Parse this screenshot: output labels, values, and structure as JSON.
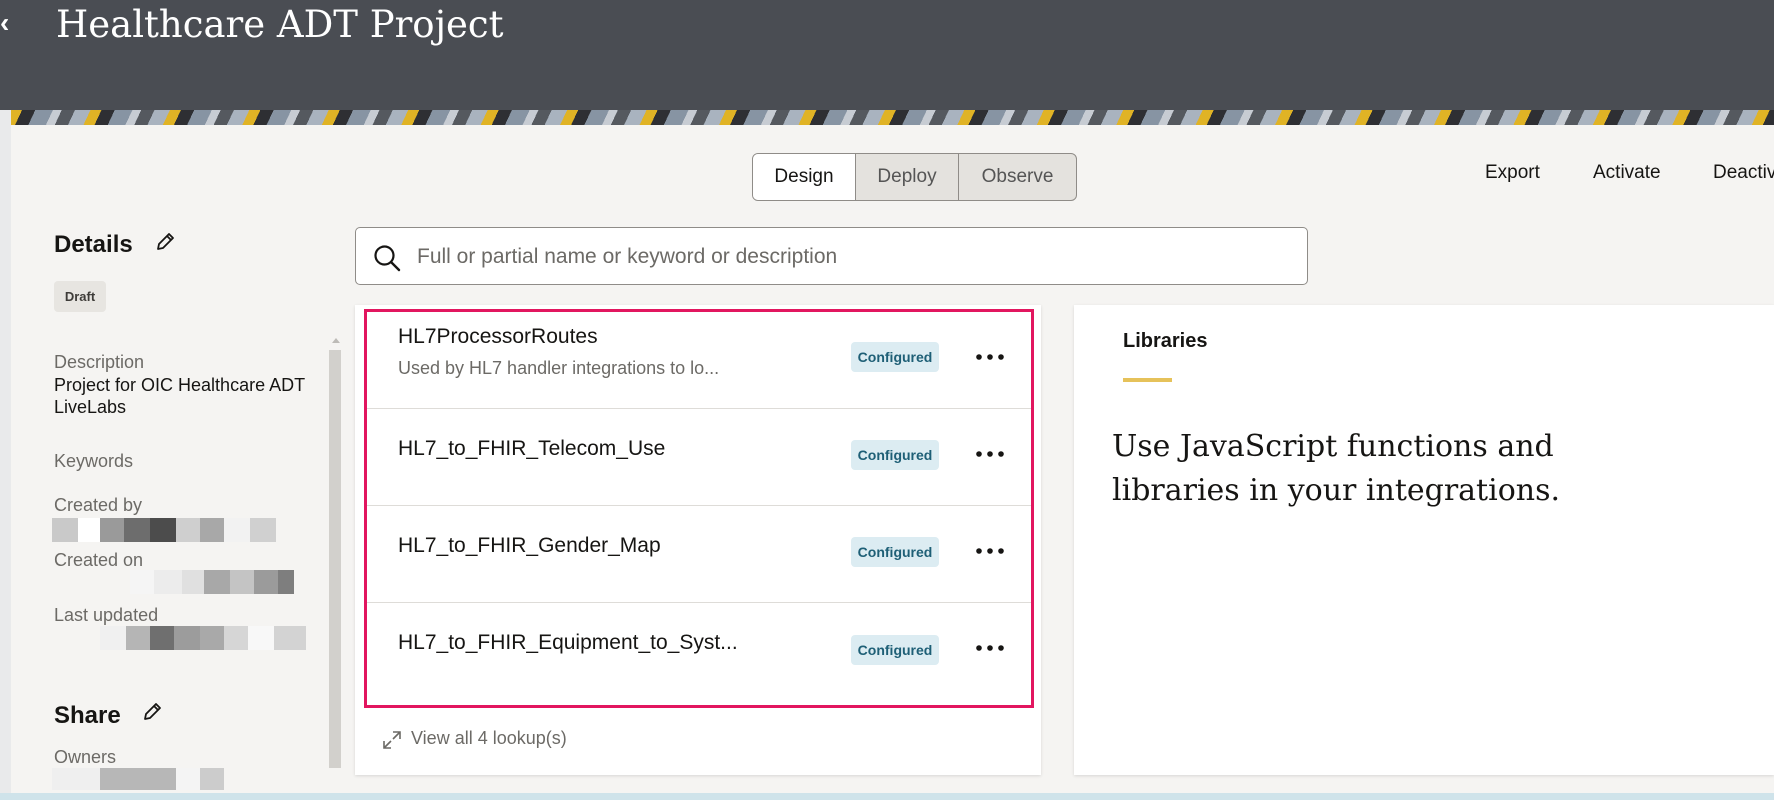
{
  "header": {
    "title": "Healthcare ADT Project",
    "back_icon": "chevron-left-icon"
  },
  "tabs": [
    {
      "label": "Design",
      "active": true
    },
    {
      "label": "Deploy",
      "active": false
    },
    {
      "label": "Observe",
      "active": false
    }
  ],
  "actions": {
    "export": "Export",
    "activate": "Activate",
    "deactivate": "Deactiv"
  },
  "details": {
    "title": "Details",
    "status": "Draft",
    "description_label": "Description",
    "description": "Project for OIC Healthcare ADT LiveLabs",
    "keywords_label": "Keywords",
    "created_by_label": "Created by",
    "created_on_label": "Created on",
    "last_updated_label": "Last updated"
  },
  "share": {
    "title": "Share",
    "owners_label": "Owners"
  },
  "search": {
    "placeholder": "Full or partial name or keyword or description"
  },
  "lookups": {
    "items": [
      {
        "name": "HL7ProcessorRoutes",
        "subtitle": "Used by HL7 handler integrations to lo...",
        "status": "Configured"
      },
      {
        "name": "HL7_to_FHIR_Telecom_Use",
        "subtitle": "",
        "status": "Configured"
      },
      {
        "name": "HL7_to_FHIR_Gender_Map",
        "subtitle": "",
        "status": "Configured"
      },
      {
        "name": "HL7_to_FHIR_Equipment_to_Syst...",
        "subtitle": "",
        "status": "Configured"
      }
    ],
    "view_all": "View all 4 lookup(s)"
  },
  "libraries": {
    "tab": "Libraries",
    "text": "Use JavaScript functions and libraries in your integrations."
  },
  "colors": {
    "highlight": "#e2165f",
    "configured_bg": "#dcecf2",
    "configured_text": "#1e5f76",
    "accent_underline": "#e6c25a"
  }
}
